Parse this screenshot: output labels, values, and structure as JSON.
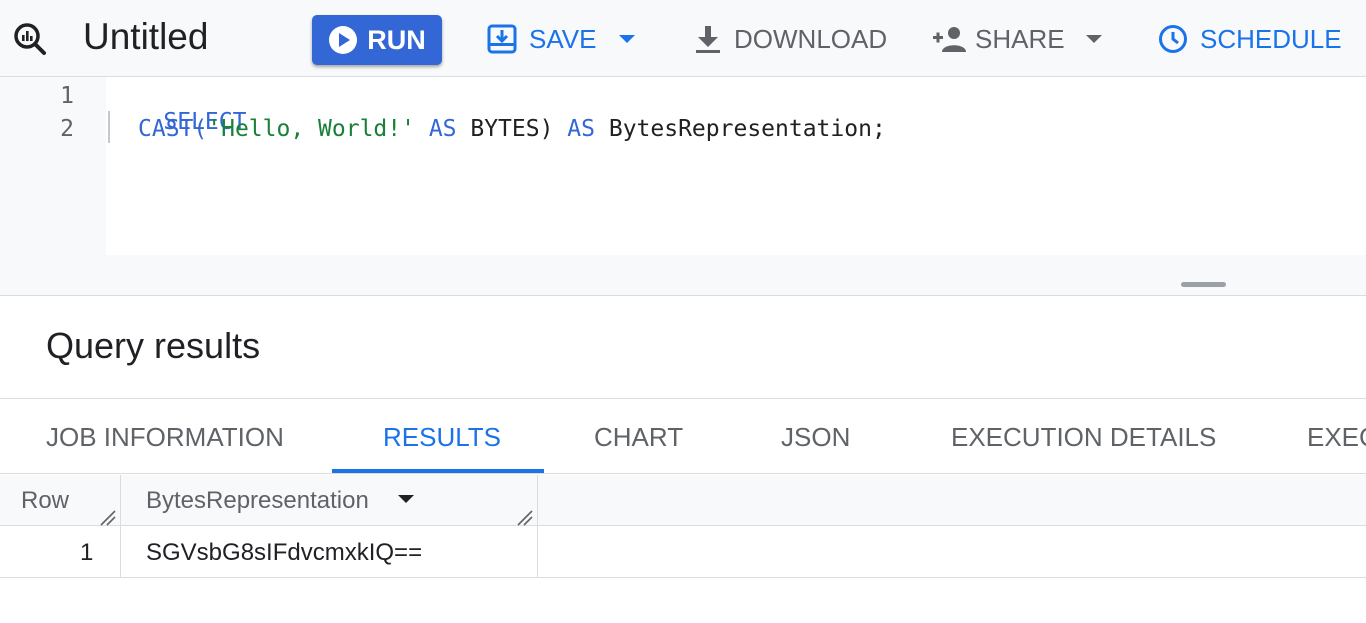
{
  "toolbar": {
    "app_icon": "query-magnifier-icon",
    "title": "Untitled",
    "run": {
      "label": "RUN",
      "icon": "play-circle-icon"
    },
    "save": {
      "label": "SAVE",
      "icon": "save-icon"
    },
    "download": {
      "label": "DOWNLOAD",
      "icon": "download-icon"
    },
    "share": {
      "label": "SHARE",
      "icon": "person-add-icon"
    },
    "schedule": {
      "label": "SCHEDULE",
      "icon": "clock-icon"
    }
  },
  "editor": {
    "lines": [
      {
        "number": "1",
        "tokens": [
          "SELECT"
        ]
      },
      {
        "number": "2",
        "tokens": [
          "CAST(",
          "'Hello, World!'",
          " AS ",
          "BYTES)",
          " AS ",
          "BytesRepresentation;"
        ]
      }
    ]
  },
  "results": {
    "title": "Query results",
    "tabs": [
      "JOB INFORMATION",
      "RESULTS",
      "CHART",
      "JSON",
      "EXECUTION DETAILS",
      "EXEC"
    ],
    "active_tab": "RESULTS",
    "columns": [
      "Row",
      "BytesRepresentation"
    ],
    "rows": [
      {
        "row": "1",
        "value": "SGVsbG8sIFdvcmxkIQ=="
      }
    ]
  },
  "colors": {
    "primary": "#3367d6",
    "link_blue": "#1a73e8",
    "string_green": "#188038",
    "muted_text": "#5f6368"
  }
}
